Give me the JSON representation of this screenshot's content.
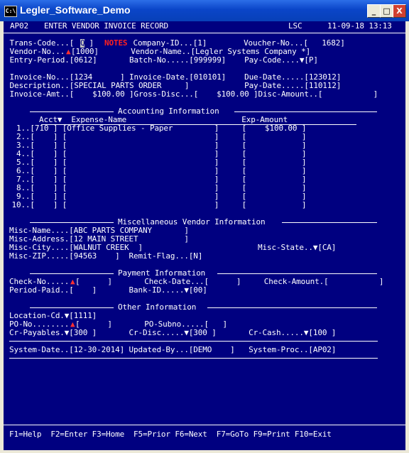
{
  "window": {
    "title": "Legler_Software_Demo",
    "icon_text": "C:\\",
    "min_label": "_",
    "max_label": "□",
    "close_label": "X"
  },
  "header": {
    "program": "AP02",
    "title": "ENTER VENDOR INVOICE RECORD",
    "company_code": "LSC",
    "date_time": "11-09-18 13:13"
  },
  "invoice_header": {
    "l1": " Trans-Code...[",
    "trans_code": "Q",
    "l1b": " ]",
    "notes": "NOTES",
    "l1c": " Company-ID...[1]        Voucher-No...[   1682]",
    "l2a": " Vendor-No...",
    "l2b": "[1000]       Vendor-Name..[Legler Systems Company *]",
    "l3": " Entry-Period.[0612]       Batch-No.....[999999]    Pay-Code....▼[P]",
    "l5": " Invoice-No...[1234      ] Invoice-Date.[010101]    Due-Date.....[123012]",
    "l6": " Description..[SPECIAL PARTS ORDER     ]            Pay-Date.....[110112]",
    "l7": " Invoice-Amt..[    $100.00 ]Gross-Disc...[    $100.00 ]Disc-Amount..[           ]"
  },
  "accounting": {
    "section_title": "Accounting Information",
    "col_headers": "Acct▼  Expense-Name                         Exp-Amount",
    "rows": [
      "  1..[710 ] [Office Supplies - Paper         ]     [    $100.00 ]",
      "  2..[    ] [                                ]     [            ]",
      "  3..[    ] [                                ]     [            ]",
      "  4..[    ] [                                ]     [            ]",
      "  5..[    ] [                                ]     [            ]",
      "  6..[    ] [                                ]     [            ]",
      "  7..[    ] [                                ]     [            ]",
      "  8..[    ] [                                ]     [            ]",
      "  9..[    ] [                                ]     [            ]",
      " 10..[    ] [                                ]     [            ]"
    ]
  },
  "misc_vendor": {
    "section_title": "Miscellaneous Vendor Information",
    "l1": "Misc-Name....[ABC PARTS COMPANY       ]",
    "l2": "Misc-Address.[12 MAIN STREET          ]",
    "l3": "Misc-City....[WALNUT CREEK  ]                         Misc-State..▼[CA]",
    "l4": "Misc-ZIP.....[94563    ]  Remit-Flag...[N]"
  },
  "payment": {
    "section_title": "Payment Information",
    "l1a": "Check-No.....",
    "l1b": "[      ]       Check-Date...[      ]     Check-Amount.[           ]",
    "l2": "Period-Paid..[    ]       Bank-ID.....▼[00]"
  },
  "other": {
    "section_title": "Other Information",
    "l1": "Location-Cd.▼[1111]",
    "l2a": "PO-No........",
    "l2b": "[      ]       PO-Subno.....[   ]",
    "l3": "Cr-Payables.▼[300 ]       Cr-Disc.....▼[300 ]       Cr-Cash.....▼[100 ]"
  },
  "system": {
    "line": "System-Date..[12-30-2014] Updated-By...[DEMO    ]   System-Proc..[AP02]"
  },
  "footer": {
    "keys": "F1=Help  F2=Enter F3=Home  F5=Prior F6=Next  F7=GoTo F9=Print F10=Exit"
  },
  "colors": {
    "screen_bg": "#000080",
    "text": "#ffffff",
    "highlight": "#ff2020",
    "titlebar": "#0a45c8"
  }
}
